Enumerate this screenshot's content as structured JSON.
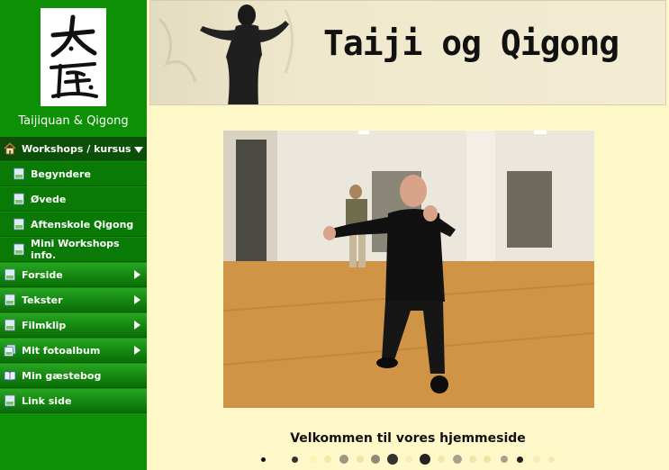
{
  "sidebar": {
    "logo_alt": "太極",
    "site_title": "Taijiquan & Qigong",
    "items": [
      {
        "label": "Workshops / kursus",
        "icon": "home-icon",
        "active": true,
        "expanded": true
      },
      {
        "label": "Begyndere",
        "icon": "page-icon",
        "sub": true
      },
      {
        "label": "Øvede",
        "icon": "page-icon",
        "sub": true
      },
      {
        "label": "Aftenskole Qigong",
        "icon": "page-icon",
        "sub": true
      },
      {
        "label": "Mini Workshops info.",
        "icon": "page-icon",
        "sub": true
      },
      {
        "label": "Forside",
        "icon": "page-icon",
        "has_children": true
      },
      {
        "label": "Tekster",
        "icon": "page-icon",
        "has_children": true
      },
      {
        "label": "Filmklip",
        "icon": "page-icon",
        "has_children": true
      },
      {
        "label": "Mit fotoalbum",
        "icon": "album-icon",
        "has_children": true
      },
      {
        "label": "Min gæstebog",
        "icon": "book-icon"
      },
      {
        "label": "Link side",
        "icon": "page-icon"
      }
    ]
  },
  "banner": {
    "title": "Taiji og Qigong"
  },
  "main": {
    "welcome": "Velkommen til vores hjemmeside"
  },
  "colors": {
    "sidebar_green": "#0d8f06",
    "page_background": "#fff8c8"
  }
}
